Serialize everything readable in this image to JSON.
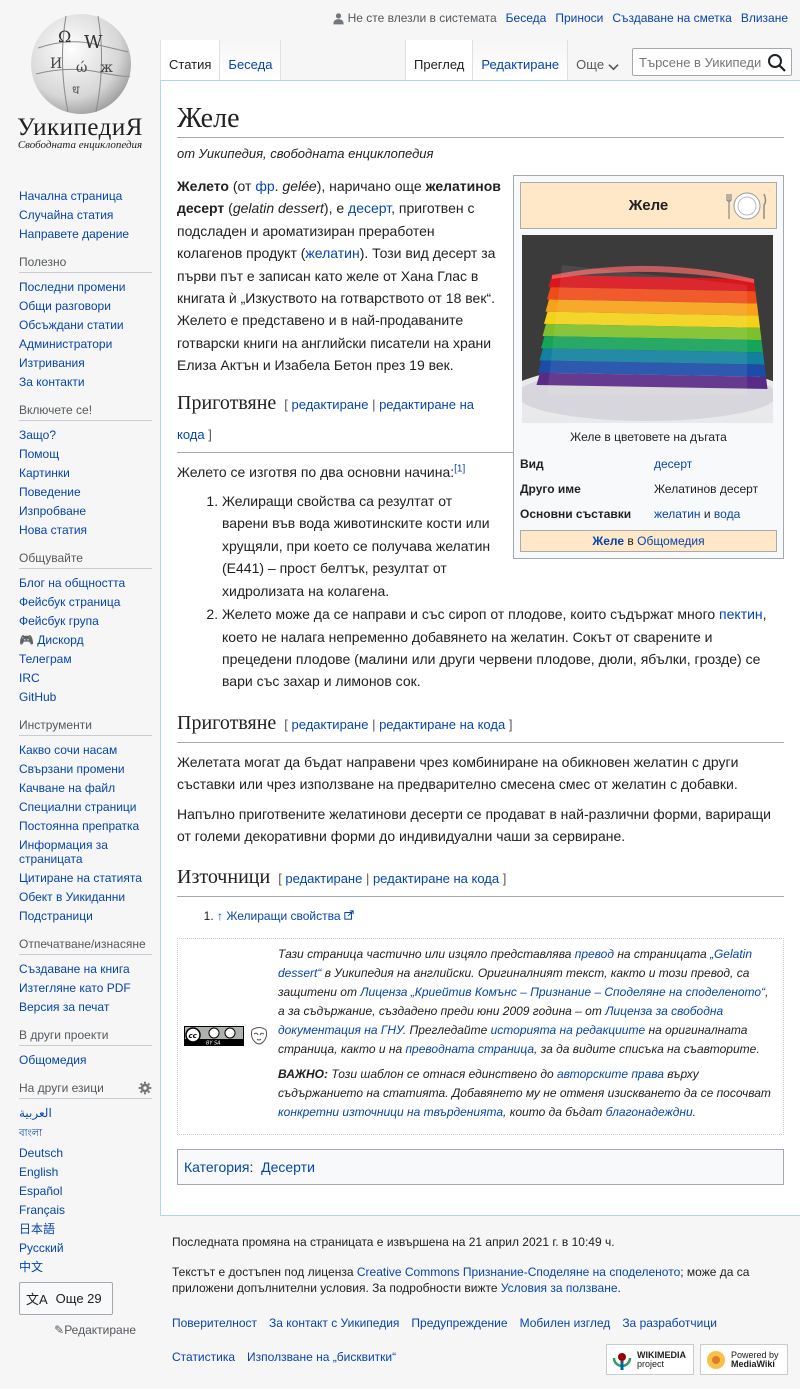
{
  "logo": {
    "wordmark": "УикипедиЯ",
    "tagline": "Свободната енциклопедия"
  },
  "personal": {
    "anon": "Не сте влезли в системата",
    "links": [
      "Беседа",
      "Приноси",
      "Създаване на сметка",
      "Влизане"
    ]
  },
  "tabs": {
    "left": [
      "Статия",
      "Беседа"
    ],
    "right": [
      "Преглед",
      "Редактиране"
    ],
    "more": "Още"
  },
  "search": {
    "placeholder": "Търсене в Уикипедия"
  },
  "sidebar": {
    "main": [
      "Начална страница",
      "Случайна статия",
      "Направете дарение"
    ],
    "portals": [
      {
        "title": "Полезно",
        "items": [
          "Последни промени",
          "Общи разговори",
          "Обсъждани статии",
          "Администратори",
          "Изтривания",
          "За контакти"
        ]
      },
      {
        "title": "Включете се!",
        "items": [
          "Защо?",
          "Помощ",
          "Картинки",
          "Поведение",
          "Изпробване",
          "Нова статия"
        ]
      },
      {
        "title": "Общувайте",
        "items": [
          "Блог на общността",
          "Фейсбук страница",
          "Фейсбук група",
          "🎮 Дискорд",
          "Телеграм",
          "IRC",
          "GitHub"
        ]
      },
      {
        "title": "Инструменти",
        "items": [
          "Какво сочи насам",
          "Свързани промени",
          "Качване на файл",
          "Специални страници",
          "Постоянна препратка",
          "Информация за страницата",
          "Цитиране на статията",
          "Обект в Уикиданни",
          "Подстраници"
        ]
      },
      {
        "title": "Отпечатване/изнасяне",
        "items": [
          "Създаване на книга",
          "Изтегляне като PDF",
          "Версия за печат"
        ]
      },
      {
        "title": "В други проекти",
        "items": [
          "Общомедия"
        ]
      }
    ],
    "languages": {
      "title": "На други езици",
      "items": [
        "العربية",
        "বাংলা",
        "Deutsch",
        "English",
        "Español",
        "Français",
        "日本語",
        "Русский",
        "中文"
      ],
      "more_button": "Още 29",
      "edit_links": "Редактиране"
    }
  },
  "article": {
    "title": "Желе",
    "sitesub": "от Уикипедия, свободната енциклопедия",
    "intro": {
      "t1": "Желето",
      "t2": " (от ",
      "fr": "фр",
      "t3": ". ",
      "gelee": "gelée",
      "t4": "), наричано още ",
      "t5": "желатинов десерт",
      "t6": " (",
      "gd": "gelatin dessert",
      "t7": "), е ",
      "dessert": "десерт",
      "t8": ", приготвен с подсладен и ароматизиран преработен колагенов продукт (",
      "gelatin": "желатин",
      "t9": "). Този вид десерт за първи път е записан като желе от Хана Глас в книгата ѝ „Изкуството на готварството от 18 век“. Желето е представено и в най-продаваните готварски книги на английски писатели на храни Елиза Актън и Изабела Бетон през 19 век."
    },
    "sections": {
      "prep1": "Приготвяне",
      "prep2": "Приготвяне",
      "sources": "Източници",
      "edit": "редактиране",
      "edit_code": "редактиране на кода"
    },
    "prep_intro": "Желето се изготвя по два основни начина:",
    "ref_mark": "[1]",
    "methods": {
      "m1": "Желиращи свойства са резултат от варени във вода животинските кости или хрущяли, при което се получава желатин (E441) – прост белтък, резултат от хидролизата на колагена.",
      "m2a": "Желето може да се направи и със сироп от плодове, които съдържат много ",
      "pectin": "пектин",
      "m2b": ", което не налага непременно добавянето на желатин. Сокът от сварените и прецедени плодове (малини или други червени плодове, дюли, ябълки, грозде) се вари със захар и лимонов сок."
    },
    "prep2_p1": "Желетата могат да бъдат направени чрез комбиниране на обикновен желатин с други съставки или чрез използване на предварително смесена смес от желатин с добавки.",
    "prep2_p2": "Напълно приготвените желатинови десерти се продават в най-различни форми, вариращи от големи декоративни форми до индивидуални чаши за сервиране.",
    "reference": {
      "arrow": "↑",
      "text": "Желиращи свойства"
    },
    "notice": {
      "a1": "Тази страница частично или изцяло представлява ",
      "translation": "превод",
      "a2": " на страницата ",
      "gelatin_link": "„Gelatin dessert“",
      "a3": " в Уикипедия на английски. Оригиналният текст, както и този превод, са защитени от ",
      "cc_license": "Лиценза „Криейтив Комънс – Признание – Споделяне на споделеното“",
      "a4": ", а за съдържание, създадено преди юни 2009 година – от ",
      "gnu_license": "Лиценза за свободна документация на ГНУ",
      "a5": ". Прегледайте ",
      "history": "историята на редакциите",
      "a6": " на оригиналната страница, както и на ",
      "translated_page": "преводната страница",
      "a7": ", за да видите списъка на съавторите.",
      "b_strong": "ВАЖНО:",
      "b1": " Този шаблон се отнася единствено до ",
      "copyright": "авторските права",
      "b2": " върху съдържанието на статията. Добавянето му не отменя изискването да се посочват ",
      "sources_link": "конкретни източници на твърденията",
      "b3": ", които да бъдат ",
      "thanks": "благонадеждни",
      "b4": "."
    },
    "categories": {
      "label": "Категория",
      "sep": ":",
      "items": [
        "Десерти"
      ]
    }
  },
  "infobox": {
    "title": "Желе",
    "caption": "Желе в цветовете на дъгата",
    "rows": {
      "type_label": "Вид",
      "type_value": "десерт",
      "other_label": "Друго име",
      "other_value": "Желатинов десерт",
      "main_label": "Основни съставки",
      "main_v1": "желатин",
      "main_and": " и ",
      "main_v2": "вода"
    },
    "footer": {
      "link1": "Желе",
      "mid": " в ",
      "link2": "Общомедия"
    },
    "layer_colors": [
      "#d8161d",
      "#ef4c1c",
      "#f7a21a",
      "#f3d21a",
      "#7ec02b",
      "#16a35a",
      "#12809e",
      "#1c4ca8",
      "#5a2b86"
    ]
  },
  "footer": {
    "lastmod": "Последната промяна на страницата е извършена на 21 април 2021 г. в 10:49 ч.",
    "lic1": "Текстът е достъпен под лиценза ",
    "lic_link": "Creative Commons Признание-Споделяне на споделеното",
    "lic2": "; може да са приложени допълнителни условия. За подробности вижте ",
    "terms": "Условия за ползване",
    "lic3": ".",
    "places": [
      "Поверителност",
      "За контакт с Уикипедия",
      "Предупреждение",
      "Мобилен изглед",
      "За разработчици"
    ],
    "places2": [
      "Статистика",
      "Използване на „бисквитки“"
    ],
    "badge1": {
      "line1": "WIKIMEDIA",
      "line2": "project"
    },
    "badge2": {
      "line1": "Powered by",
      "line2": "MediaWiki"
    }
  }
}
